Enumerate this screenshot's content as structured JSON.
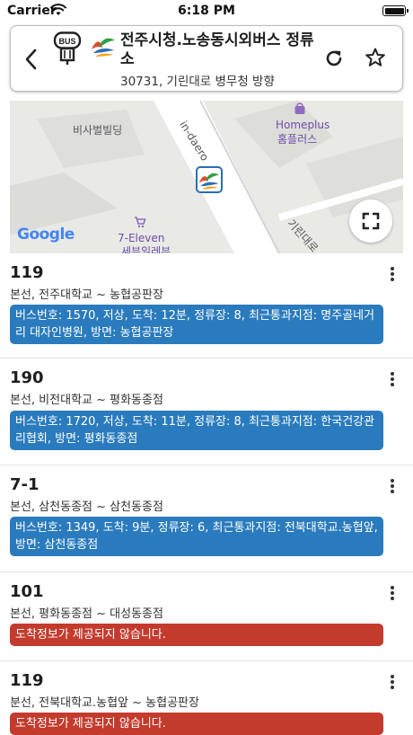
{
  "status_bar": {
    "carrier": "Carrier",
    "time": "6:18 PM"
  },
  "header": {
    "bus_badge": "BUS",
    "title": "전주시청.노송동시외버스 정류소",
    "subtitle": "30731, 기린대로 병무청 방향"
  },
  "map": {
    "labels": {
      "building1": "비사벌빌딩",
      "road1": "in-daero",
      "homeplus_en": "Homeplus",
      "homeplus_ko": "홈플러스",
      "seven_eleven": "7-Eleven",
      "seven_eleven_sub": "세븐일레븐",
      "road2": "기린대로"
    },
    "google": "Google"
  },
  "buses": [
    {
      "route": "119",
      "desc": "본선, 전주대학교 ~ 농협공판장",
      "info": "버스번호: 1570, 저상, 도착: 12분, 정류장: 8, 최근통과지점: 명주골네거리 대자인병원, 방면: 농협공판장",
      "status": "blue"
    },
    {
      "route": "190",
      "desc": "본선, 비전대학교 ~ 평화동종점",
      "info": "버스번호: 1720, 저상, 도착: 11분, 정류장: 8, 최근통과지점: 한국건강관리협회, 방면: 평화동종점",
      "status": "blue"
    },
    {
      "route": "7-1",
      "desc": "본선, 삼천동종점 ~ 삼천동종점",
      "info": "버스번호: 1349, 도착: 9분, 정류장: 6, 최근통과지점: 전북대학교.농협앞, 방면: 삼천동종점",
      "status": "blue"
    },
    {
      "route": "101",
      "desc": "본선, 평화동종점 ~ 대성동종점",
      "info": "도착정보가 제공되지 않습니다.",
      "status": "red"
    },
    {
      "route": "119",
      "desc": "분선, 전북대학교.농협앞 ~ 농협공판장",
      "info": "도착정보가 제공되지 않습니다.",
      "status": "red"
    }
  ],
  "colors": {
    "accent_blue": "#2a7bbd",
    "alert_red": "#c33b2d",
    "marker_blue": "#2a6db5"
  },
  "icons": {
    "back": "chevron-left-icon",
    "bus_stop": "bus-stop-icon",
    "refresh": "refresh-icon",
    "star": "star-outline-icon",
    "more": "more-vertical-icon",
    "fullscreen": "fullscreen-icon"
  }
}
